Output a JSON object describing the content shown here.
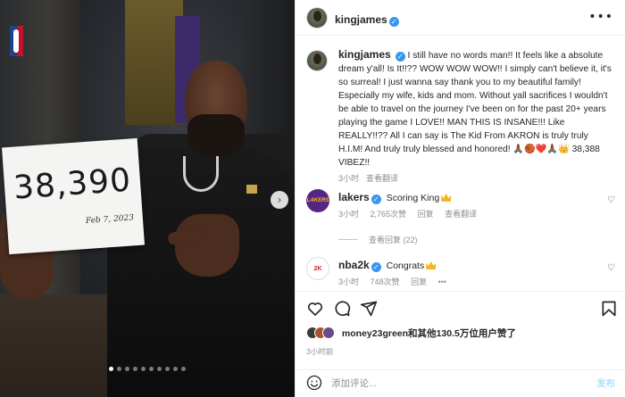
{
  "photo": {
    "sign_number": "38,390",
    "sign_date": "Feb 7, 2023",
    "logo": "nba-logo",
    "carousel": {
      "count": 10,
      "active_index": 0
    },
    "next_icon": "chevron-right-icon"
  },
  "header": {
    "username": "kingjames",
    "verified_icon": "verified-badge-icon",
    "more_icon": "more-horizontal-icon"
  },
  "caption": {
    "username": "kingjames",
    "text": "I still have no words man!! It feels like a absolute dream y'all! Is It!!?? WOW WOW WOW!! I simply can't believe it, it's so surreal! I just wanna say thank you to my beautiful family! Especially my wife, kids and mom. Without yall sacrifices I wouldn't be able to travel on the journey I've been on for the past 20+ years playing the game I LOVE!! MAN THIS IS INSANE!!! Like REALLY!!?? All I can say is The Kid From AKRON is truly truly H.I.M! And truly truly blessed and honored! 🙏🏾🏀❤️🙏🏾👑 38,388 VIBEZ!!",
    "time": "3小时",
    "translate": "查看翻译"
  },
  "comments": [
    {
      "username": "lakers",
      "text": "Scoring King",
      "time": "3小时",
      "likes": "2,765次赞",
      "reply": "回复",
      "translate": "查看翻译",
      "avatar_text": "LAKERS"
    },
    {
      "username": "nba2k",
      "text": "Congrats",
      "time": "3小时",
      "likes": "748次赞",
      "reply": "回复",
      "avatar_text": "2K"
    }
  ],
  "view_replies": "查看回复 (22)",
  "actions": {
    "like_icon": "heart-icon",
    "comment_icon": "comment-icon",
    "share_icon": "send-icon",
    "save_icon": "bookmark-icon"
  },
  "likes": {
    "user": "money23green",
    "text": "和其他130.5万位用户赞了"
  },
  "post_time": "3小时前",
  "add_comment": {
    "emoji_icon": "emoji-icon",
    "placeholder": "添加评论...",
    "post_label": "发布"
  },
  "colors": {
    "verified": "#3897f0",
    "lakers_purple": "#552583",
    "lakers_gold": "#fdb927",
    "post_disabled": "#b2dffc"
  }
}
